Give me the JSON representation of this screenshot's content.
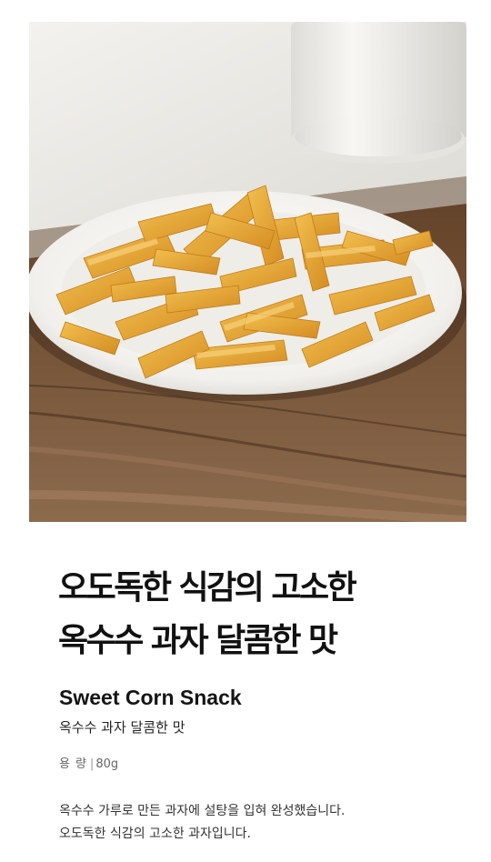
{
  "product": {
    "headline_line1": "오도독한 식감의 고소한",
    "headline_line2": "옥수수 과자 달콤한 맛",
    "name_en": "Sweet Corn Snack",
    "name_ko": "옥수수 과자 달콤한 맛",
    "spec_label": "용량",
    "spec_separator": "|",
    "spec_value": "80g",
    "description_line1": "옥수수 가루로 만든 과자에 설탕을 입혀 완성했습니다.",
    "description_line2": "오도독한 식감의 고소한 과자입니다."
  },
  "photo": {
    "icon": "corn-snack-plate-photo",
    "colors": {
      "table": "#6b4a2e",
      "cloth": "#ecebe6",
      "plate": "#f4f3ef",
      "snack": "#e8a534",
      "cup": "#f2f1ee"
    }
  }
}
